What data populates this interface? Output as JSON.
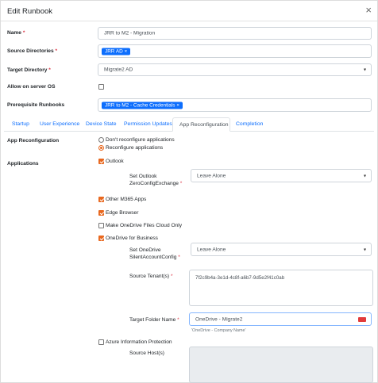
{
  "dialog": {
    "title": "Edit Runbook",
    "close_icon": "close-icon"
  },
  "fields": {
    "name_label": "Name",
    "name_value": "JRR to M2 - Migration",
    "source_dirs_label": "Source Directories",
    "source_dirs_tags": [
      "JRR AD ×"
    ],
    "target_dir_label": "Target Directory",
    "target_dir_value": "Migrate2 AD",
    "allow_server_label": "Allow on server OS",
    "prereq_label": "Prerequisite Runbooks",
    "prereq_tags": [
      "JRR to M2 - Cache Credentials ×"
    ],
    "required_mark": "*"
  },
  "tabs": [
    "Startup",
    "User Experience",
    "Device State",
    "Permission Updates",
    "App Reconfiguration",
    "Completion"
  ],
  "active_tab": "App Reconfiguration",
  "app_reconfig": {
    "section_label": "App Reconfiguration",
    "options": [
      "Don't reconfigure applications",
      "Reconfigure applications"
    ],
    "selected": "Reconfigure applications"
  },
  "applications": {
    "section_label": "Applications",
    "outlook": {
      "label": "Outlook",
      "checked": true
    },
    "outlook_setting_label_1": "Set Outlook",
    "outlook_setting_label_2": "ZeroConfigExchange",
    "outlook_setting_value": "Leave Alone",
    "other_m365": {
      "label": "Other M365 Apps",
      "checked": true
    },
    "edge": {
      "label": "Edge Browser",
      "checked": true
    },
    "onedrive_cloud_only": {
      "label": "Make OneDrive Files Cloud Only",
      "checked": false
    },
    "onedrive_business": {
      "label": "OneDrive for Business",
      "checked": true
    },
    "onedrive_setting_label_1": "Set OneDrive",
    "onedrive_setting_label_2": "SilentAccountConfig",
    "onedrive_setting_value": "Leave Alone",
    "source_tenant_label": "Source Tenant(s)",
    "source_tenant_value": "7f2c9b4a-3e1d-4c8f-a6b7-9d5e2f41c0ab",
    "target_folder_label": "Target Folder Name",
    "target_folder_value": "OneDrive - Migrate2",
    "target_folder_hint": "'OneDrive - Company Name'",
    "azure_ip": {
      "label": "Azure Information Protection",
      "checked": false
    },
    "source_hosts_label": "Source Host(s)"
  },
  "colors": {
    "accent": "#e8681f",
    "tag": "#0d6efd",
    "link": "#0d6efd",
    "required": "#dc3545"
  }
}
